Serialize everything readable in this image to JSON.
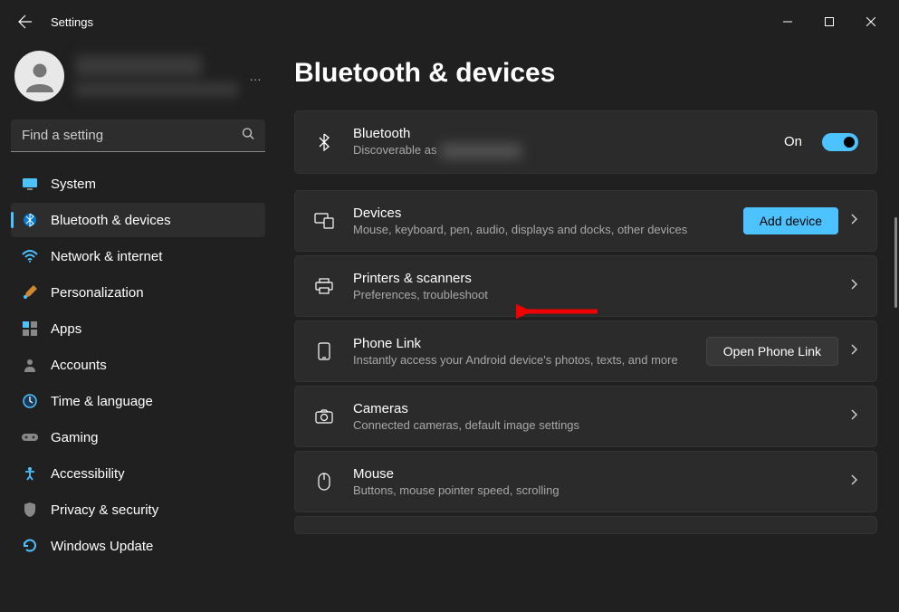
{
  "window": {
    "title": "Settings"
  },
  "search": {
    "placeholder": "Find a setting"
  },
  "sidebar": {
    "items": [
      {
        "label": "System"
      },
      {
        "label": "Bluetooth & devices"
      },
      {
        "label": "Network & internet"
      },
      {
        "label": "Personalization"
      },
      {
        "label": "Apps"
      },
      {
        "label": "Accounts"
      },
      {
        "label": "Time & language"
      },
      {
        "label": "Gaming"
      },
      {
        "label": "Accessibility"
      },
      {
        "label": "Privacy & security"
      },
      {
        "label": "Windows Update"
      }
    ]
  },
  "page": {
    "title": "Bluetooth & devices"
  },
  "cards": {
    "bluetooth": {
      "title": "Bluetooth",
      "subtitle_prefix": "Discoverable as ",
      "toggle_label": "On"
    },
    "devices": {
      "title": "Devices",
      "subtitle": "Mouse, keyboard, pen, audio, displays and docks, other devices",
      "button": "Add device"
    },
    "printers": {
      "title": "Printers & scanners",
      "subtitle": "Preferences, troubleshoot"
    },
    "phone": {
      "title": "Phone Link",
      "subtitle": "Instantly access your Android device's photos, texts, and more",
      "button": "Open Phone Link"
    },
    "cameras": {
      "title": "Cameras",
      "subtitle": "Connected cameras, default image settings"
    },
    "mouse": {
      "title": "Mouse",
      "subtitle": "Buttons, mouse pointer speed, scrolling"
    }
  }
}
